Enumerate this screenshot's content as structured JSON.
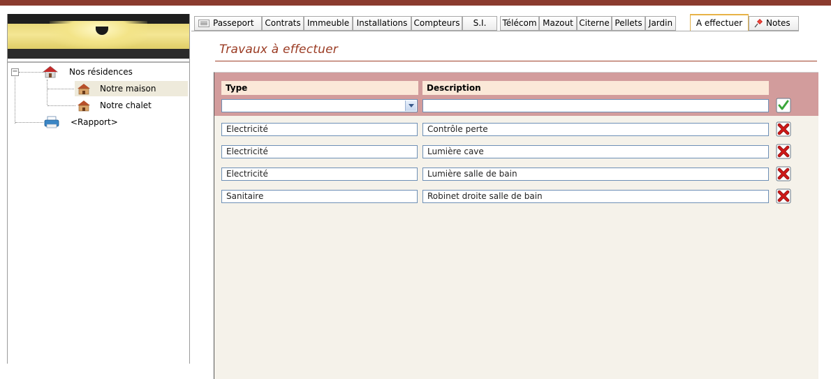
{
  "tree": {
    "root_label": "Nos résidences",
    "children": [
      "Notre maison",
      "Notre chalet"
    ],
    "report_label": "<Rapport>"
  },
  "tabs": [
    {
      "label": "Passeport",
      "icon": "list-icon"
    },
    {
      "label": "Contrats"
    },
    {
      "label": "Immeuble"
    },
    {
      "label": "Installations"
    },
    {
      "label": "Compteurs"
    },
    {
      "label": "S.I."
    },
    {
      "label": "Télécom"
    },
    {
      "label": "Mazout"
    },
    {
      "label": "Citerne"
    },
    {
      "label": "Pellets"
    },
    {
      "label": "Jardin"
    },
    {
      "label": "A effectuer",
      "active": true
    },
    {
      "label": "Notes",
      "icon": "pin-icon"
    }
  ],
  "page": {
    "title": "Travaux à effectuer"
  },
  "table": {
    "headers": {
      "type": "Type",
      "description": "Description"
    },
    "new_row": {
      "type": "",
      "description": ""
    },
    "rows": [
      {
        "type": "Electricité",
        "description": "Contrôle perte"
      },
      {
        "type": "Electricité",
        "description": "Lumière cave"
      },
      {
        "type": "Electricité",
        "description": "Lumière salle de bain"
      },
      {
        "type": "Sanitaire",
        "description": "Robinet droite salle de bain"
      }
    ]
  },
  "colors": {
    "accent": "#9a3a22",
    "header_band": "#d29c9c",
    "active_tab": "#e8b246",
    "confirm_green": "#3aa63a",
    "delete_red": "#d01818"
  }
}
